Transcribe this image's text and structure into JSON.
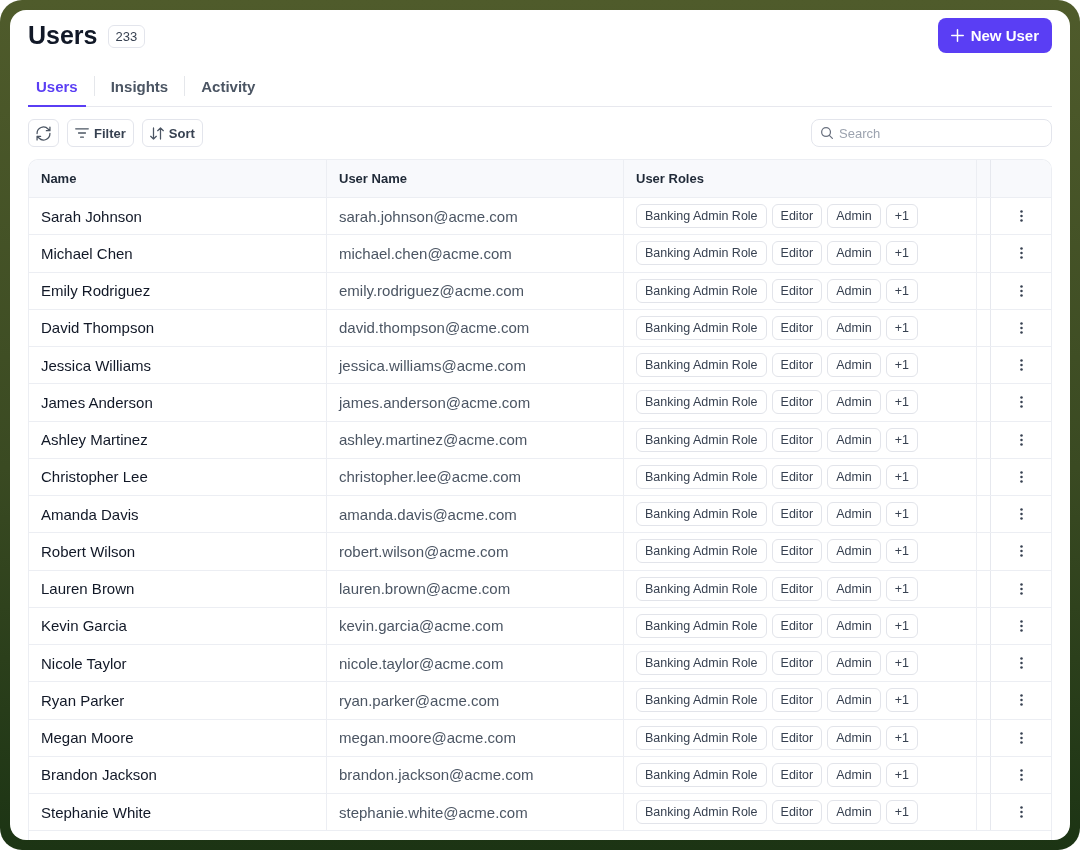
{
  "header": {
    "title": "Users",
    "count": "233",
    "new_button": "New User"
  },
  "tabs": [
    {
      "label": "Users",
      "selected": true
    },
    {
      "label": "Insights",
      "selected": false
    },
    {
      "label": "Activity",
      "selected": false
    }
  ],
  "toolbar": {
    "buttons": [
      {
        "kind": "refresh"
      },
      {
        "kind": "filter",
        "label": "Filter"
      },
      {
        "kind": "sort",
        "label": "Sort"
      }
    ],
    "search": {
      "placeholder": "Search"
    }
  },
  "table": {
    "columns": [
      "Name",
      "User Name",
      "User Roles"
    ],
    "rows": [
      {
        "name": "Sarah Johnson",
        "user_name": "sarah.johnson@acme.com",
        "roles": [
          "Banking Admin Role",
          "Editor",
          "Admin"
        ],
        "more_roles": "+1"
      },
      {
        "name": "Michael Chen",
        "user_name": "michael.chen@acme.com",
        "roles": [
          "Banking Admin Role",
          "Editor",
          "Admin"
        ],
        "more_roles": "+1"
      },
      {
        "name": "Emily Rodriguez",
        "user_name": "emily.rodriguez@acme.com",
        "roles": [
          "Banking Admin Role",
          "Editor",
          "Admin"
        ],
        "more_roles": "+1"
      },
      {
        "name": "David Thompson",
        "user_name": "david.thompson@acme.com",
        "roles": [
          "Banking Admin Role",
          "Editor",
          "Admin"
        ],
        "more_roles": "+1"
      },
      {
        "name": "Jessica Williams",
        "user_name": "jessica.williams@acme.com",
        "roles": [
          "Banking Admin Role",
          "Editor",
          "Admin"
        ],
        "more_roles": "+1"
      },
      {
        "name": "James Anderson",
        "user_name": "james.anderson@acme.com",
        "roles": [
          "Banking Admin Role",
          "Editor",
          "Admin"
        ],
        "more_roles": "+1"
      },
      {
        "name": "Ashley Martinez",
        "user_name": "ashley.martinez@acme.com",
        "roles": [
          "Banking Admin Role",
          "Editor",
          "Admin"
        ],
        "more_roles": "+1"
      },
      {
        "name": "Christopher Lee",
        "user_name": "christopher.lee@acme.com",
        "roles": [
          "Banking Admin Role",
          "Editor",
          "Admin"
        ],
        "more_roles": "+1"
      },
      {
        "name": "Amanda Davis",
        "user_name": "amanda.davis@acme.com",
        "roles": [
          "Banking Admin Role",
          "Editor",
          "Admin"
        ],
        "more_roles": "+1"
      },
      {
        "name": "Robert Wilson",
        "user_name": "robert.wilson@acme.com",
        "roles": [
          "Banking Admin Role",
          "Editor",
          "Admin"
        ],
        "more_roles": "+1"
      },
      {
        "name": "Lauren Brown",
        "user_name": "lauren.brown@acme.com",
        "roles": [
          "Banking Admin Role",
          "Editor",
          "Admin"
        ],
        "more_roles": "+1"
      },
      {
        "name": "Kevin Garcia",
        "user_name": "kevin.garcia@acme.com",
        "roles": [
          "Banking Admin Role",
          "Editor",
          "Admin"
        ],
        "more_roles": "+1"
      },
      {
        "name": "Nicole Taylor",
        "user_name": "nicole.taylor@acme.com",
        "roles": [
          "Banking Admin Role",
          "Editor",
          "Admin"
        ],
        "more_roles": "+1"
      },
      {
        "name": "Ryan Parker",
        "user_name": "ryan.parker@acme.com",
        "roles": [
          "Banking Admin Role",
          "Editor",
          "Admin"
        ],
        "more_roles": "+1"
      },
      {
        "name": "Megan Moore",
        "user_name": "megan.moore@acme.com",
        "roles": [
          "Banking Admin Role",
          "Editor",
          "Admin"
        ],
        "more_roles": "+1"
      },
      {
        "name": "Brandon Jackson",
        "user_name": "brandon.jackson@acme.com",
        "roles": [
          "Banking Admin Role",
          "Editor",
          "Admin"
        ],
        "more_roles": "+1"
      },
      {
        "name": "Stephanie White",
        "user_name": "stephanie.white@acme.com",
        "roles": [
          "Banking Admin Role",
          "Editor",
          "Admin"
        ],
        "more_roles": "+1"
      }
    ]
  }
}
